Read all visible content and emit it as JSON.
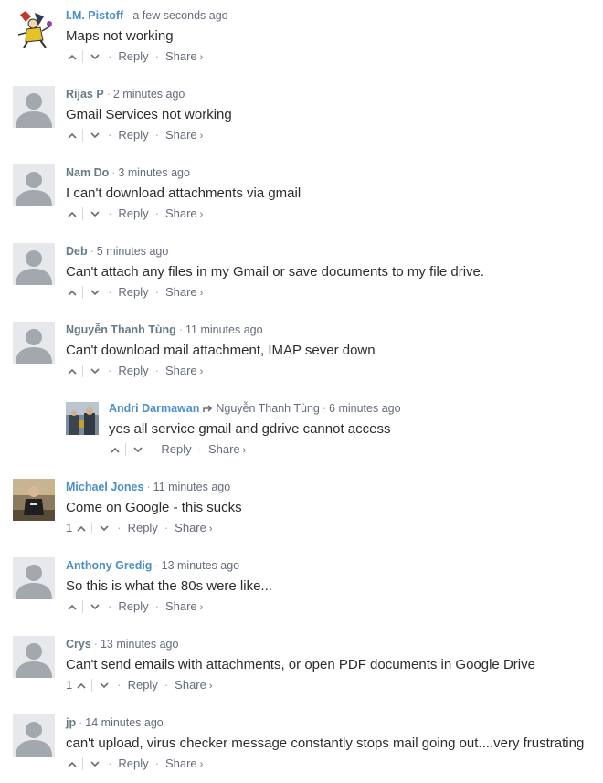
{
  "ui": {
    "reply_label": "Reply",
    "share_label": "Share",
    "share_chevron": "›",
    "meta_dot": "·"
  },
  "comments": [
    {
      "author": "I.M. Pistoff",
      "time": "a few seconds ago",
      "text": "Maps not working",
      "votes": "",
      "avatar": "cartoon-avatar",
      "author_link": true
    },
    {
      "author": "Rijas P",
      "time": "2 minutes ago",
      "text": "Gmail Services not working",
      "votes": "",
      "avatar": "default-avatar",
      "author_link": false
    },
    {
      "author": "Nam Do",
      "time": "3 minutes ago",
      "text": "I can't download attachments via gmail",
      "votes": "",
      "avatar": "default-avatar",
      "author_link": false
    },
    {
      "author": "Deb",
      "time": "5 minutes ago",
      "text": "Can't attach any files in my Gmail or save documents to my file drive.",
      "votes": "",
      "avatar": "default-avatar",
      "author_link": false
    },
    {
      "author": "Nguyễn Thanh Tùng",
      "time": "11 minutes ago",
      "text": "Can't download mail attachment, IMAP sever down",
      "votes": "",
      "avatar": "default-avatar",
      "author_link": false
    },
    {
      "author": "Andri Darmawan",
      "time": "6 minutes ago",
      "text": "yes all service gmail and gdrive cannot access",
      "votes": "",
      "avatar": "photo-avatar",
      "author_link": true,
      "reply_to": "Nguyễn Thanh Tùng"
    },
    {
      "author": "Michael Jones",
      "time": "11 minutes ago",
      "text": "Come on Google - this sucks",
      "votes": "1",
      "avatar": "photo-avatar",
      "author_link": true
    },
    {
      "author": "Anthony Gredig",
      "time": "13 minutes ago",
      "text": "So this is what the 80s were like...",
      "votes": "",
      "avatar": "default-avatar",
      "author_link": true
    },
    {
      "author": "Crys",
      "time": "13 minutes ago",
      "text": "Can't send emails with attachments, or open PDF documents in Google Drive",
      "votes": "1",
      "avatar": "default-avatar",
      "author_link": false
    },
    {
      "author": "jp",
      "time": "14 minutes ago",
      "text": "can't upload, virus checker message constantly stops mail going out....very frustrating",
      "votes": "",
      "avatar": "default-avatar",
      "author_link": false
    }
  ]
}
